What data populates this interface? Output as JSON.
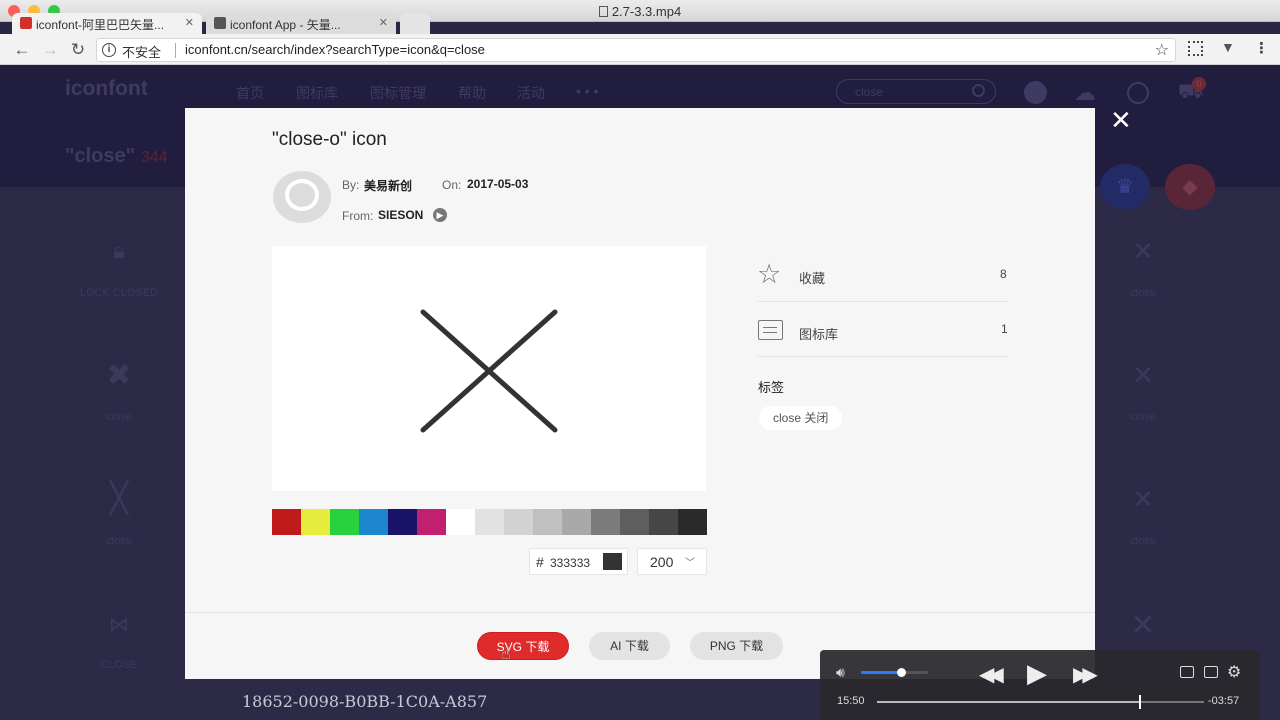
{
  "window": {
    "title": "2.7-3.3.mp4",
    "tabs": [
      {
        "label": "iconfont-阿里巴巴矢量..."
      },
      {
        "label": "iconfont App - 矢量..."
      }
    ]
  },
  "browser": {
    "insecure_label": "不安全",
    "url": "iconfont.cn/search/index?searchType=icon&q=close"
  },
  "site": {
    "logo": "iconfont",
    "nav": [
      "首页",
      "图标库",
      "图标管理",
      "帮助",
      "活动",
      "• • •"
    ],
    "search_value": "close",
    "cart_count": "0",
    "search_heading": "\"close\"",
    "result_count": "344"
  },
  "grid": {
    "left_labels": [
      "LOCK CLOSED",
      "close",
      "close",
      "CLOSE"
    ],
    "right_labels": [
      "close",
      "close",
      "close",
      "close"
    ]
  },
  "modal": {
    "title": "\"close-o\" icon",
    "by_label": "By:",
    "author": "美易新创",
    "on_label": "On:",
    "date": "2017-05-03",
    "from_label": "From:",
    "source": "SIESON",
    "stats": [
      {
        "label": "收藏",
        "value": "8",
        "icon": "star-icon"
      },
      {
        "label": "图标库",
        "value": "1",
        "icon": "library-icon"
      }
    ],
    "tags_heading": "标签",
    "tags": [
      "close 关闭"
    ],
    "palette": [
      "#c01b1b",
      "#e7ec3c",
      "#27d23e",
      "#1c86cf",
      "#191467",
      "#c11f6f",
      "#ffffff",
      "#e2e2e2",
      "#d2d2d2",
      "#c0c0c0",
      "#a9a9a9",
      "#7b7b7b",
      "#5e5e5e",
      "#464646",
      "#2a2a2a"
    ],
    "color_hash": "#",
    "color_value": "333333",
    "size_value": "200",
    "buttons": {
      "svg": "SVG 下载",
      "ai": "AI 下载",
      "png": "PNG 下载"
    }
  },
  "player": {
    "elapsed": "15:50",
    "remaining": "-03:57",
    "volume": 0.6,
    "progress": 0.8
  },
  "watermark": "18652-0098-B0BB-1C0A-A857",
  "colors": {
    "accent": "#e02b2b",
    "page_bg": "#2d2a48"
  }
}
